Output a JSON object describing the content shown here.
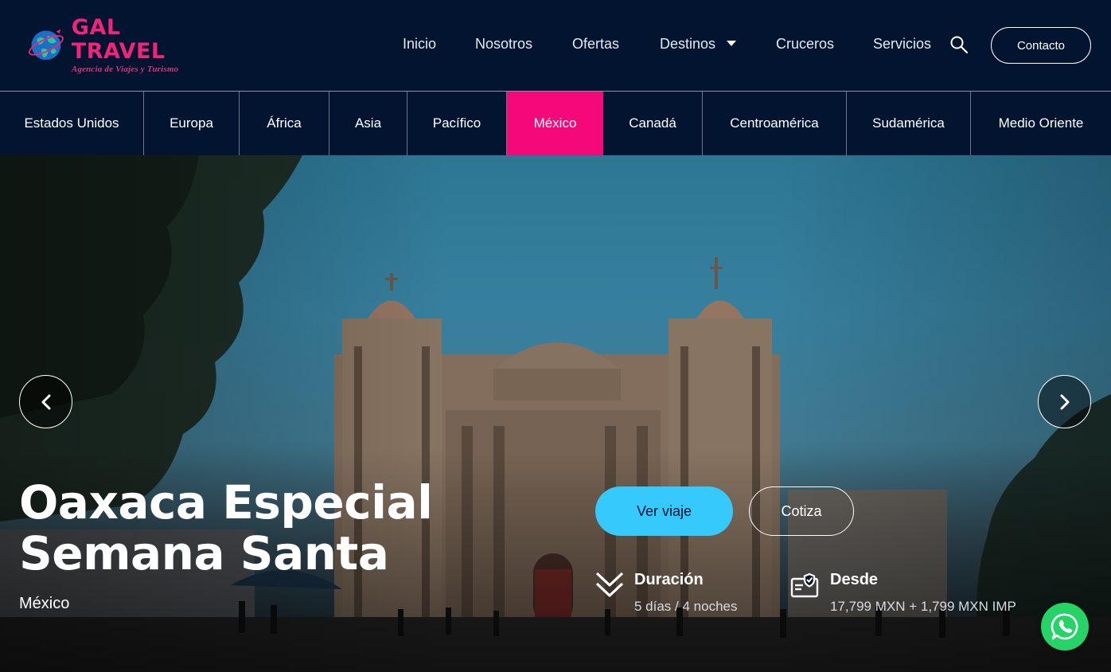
{
  "brand": {
    "name": "GAL TRAVEL",
    "tagline": "Agencia de Viajes y Turismo",
    "accent": "#f0247a"
  },
  "nav": {
    "items": [
      {
        "label": "Inicio"
      },
      {
        "label": "Nosotros"
      },
      {
        "label": "Ofertas"
      },
      {
        "label": "Destinos"
      },
      {
        "label": "Cruceros"
      },
      {
        "label": "Servicios"
      }
    ],
    "search_icon": "search-icon",
    "contact_label": "Contacto"
  },
  "categories": {
    "items": [
      {
        "label": "Estados Unidos"
      },
      {
        "label": "Europa"
      },
      {
        "label": "África"
      },
      {
        "label": "Asia"
      },
      {
        "label": "Pacífico"
      },
      {
        "label": "México"
      },
      {
        "label": "Canadá"
      },
      {
        "label": "Centroamérica"
      },
      {
        "label": "Sudamérica"
      },
      {
        "label": "Medio Oriente"
      }
    ],
    "active": "México",
    "active_color": "#f4087a"
  },
  "hero": {
    "title": "Oaxaca Especial Semana Santa",
    "country": "México",
    "view_button": "Ver viaje",
    "quote_button": "Cotiza",
    "duration": {
      "label": "Duración",
      "value": "5 días / 4 noches",
      "icon": "chevrons-down-icon"
    },
    "price": {
      "label": "Desde",
      "value": "17,799 MXN + 1,799 MXN IMP",
      "icon": "price-tag-icon"
    },
    "button_color": "#36c9fb"
  },
  "whatsapp": {
    "icon": "whatsapp-icon",
    "color": "#25d366"
  }
}
